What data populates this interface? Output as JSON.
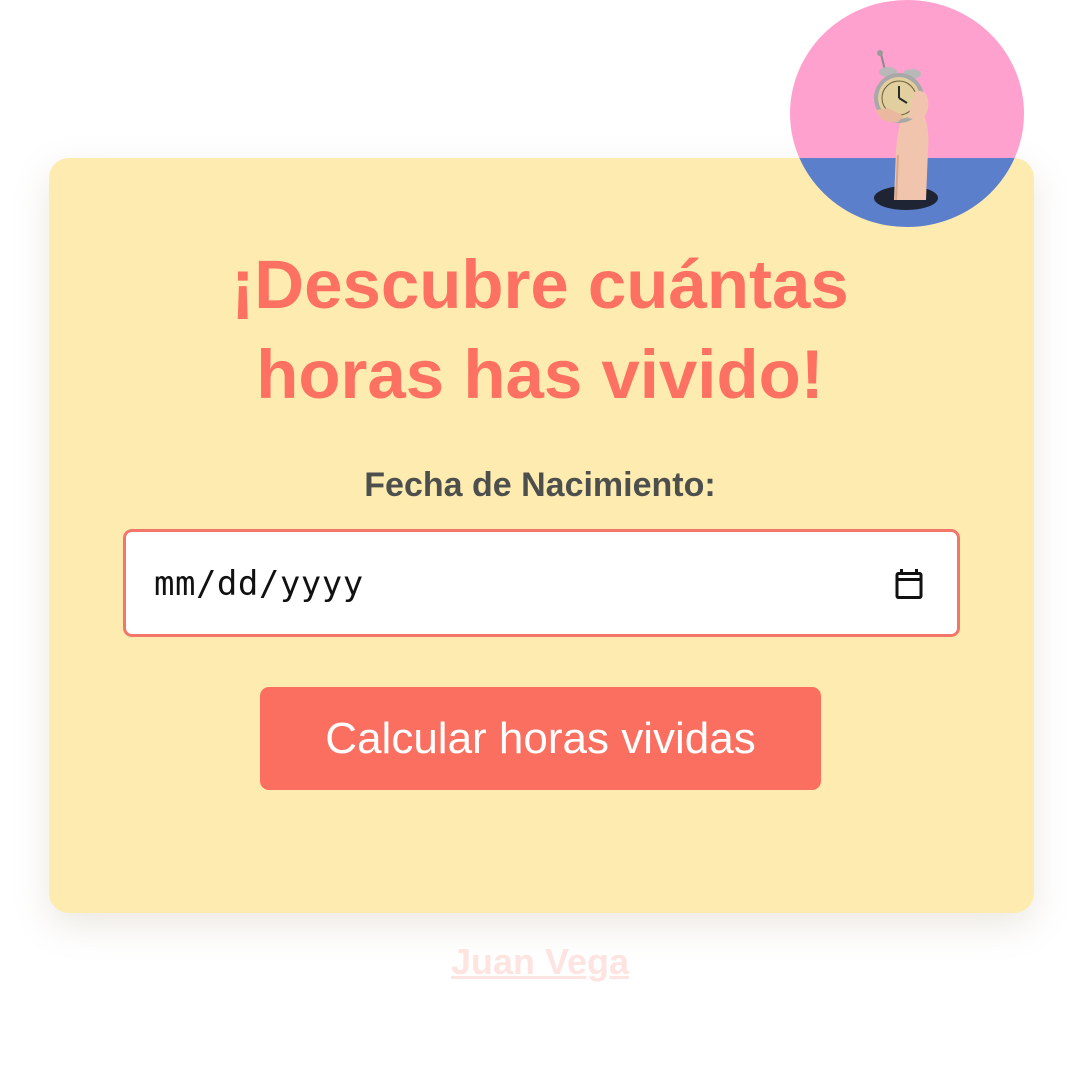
{
  "heading": {
    "line1": "¡Descubre cuántas",
    "line2": "horas has vivido!"
  },
  "form": {
    "birthdate_label": "Fecha de Nacimiento:",
    "birthdate_placeholder": "mm/dd/yyyy",
    "submit_label": "Calcular horas vividas"
  },
  "footer": {
    "author_link": "Juan Vega"
  },
  "icons": {
    "calendar": "calendar-icon",
    "avatar": "hand-holding-alarm-clock"
  },
  "colors": {
    "card_background": "#feebb0",
    "accent": "#fd7162",
    "label_text": "#4d4f4d",
    "footer_link": "#fde4e0",
    "avatar_pink": "#ffa1ce",
    "avatar_blue": "#5c7fcc"
  }
}
